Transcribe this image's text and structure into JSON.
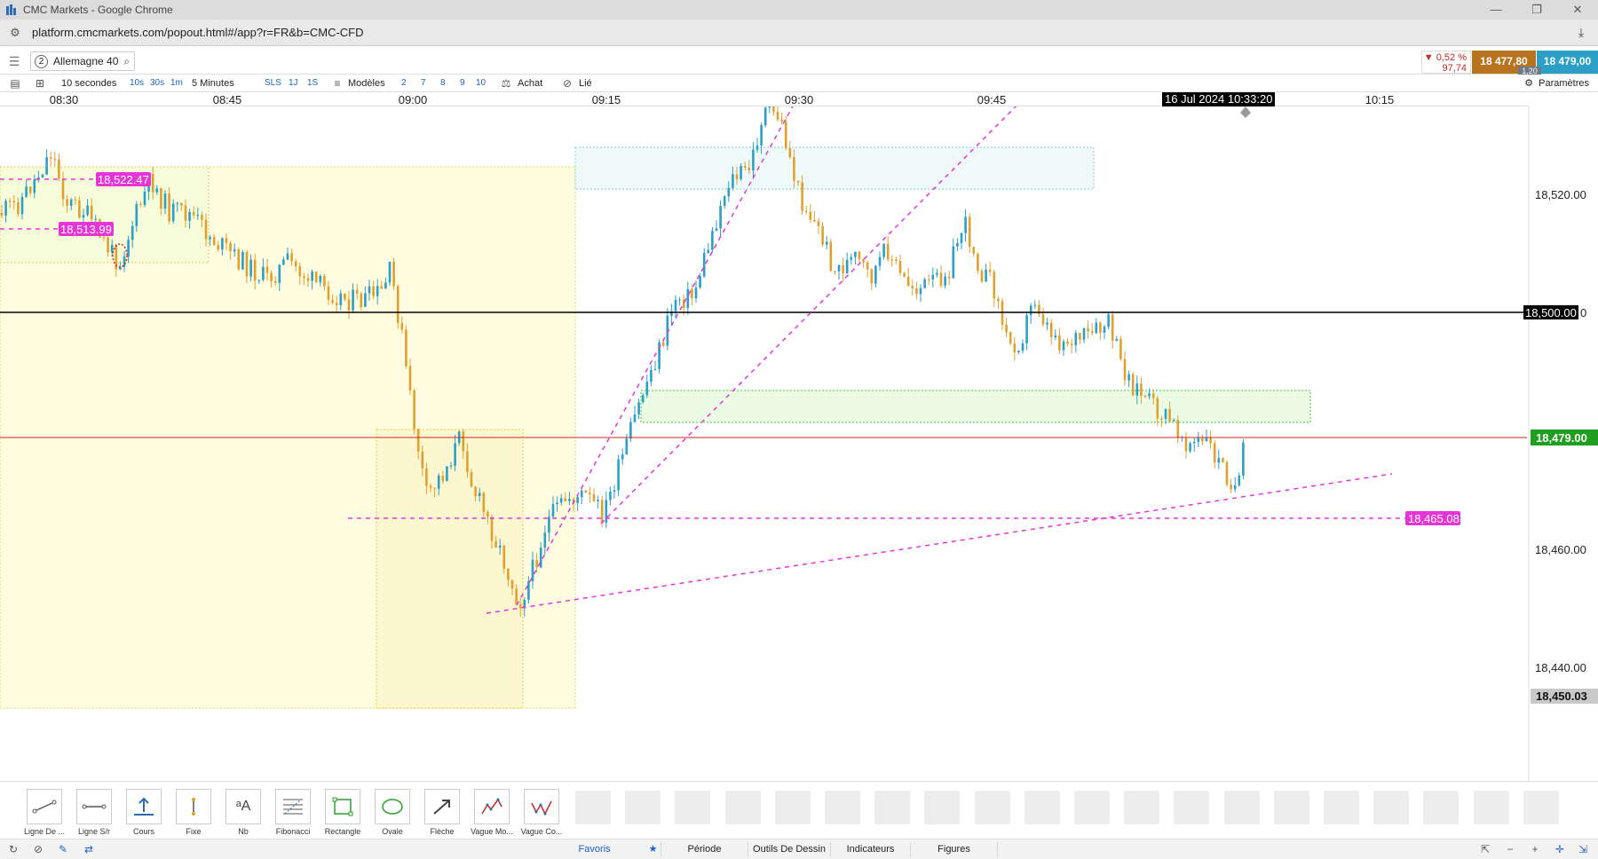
{
  "window": {
    "title": "CMC Markets - Google Chrome",
    "minimize": "—",
    "maximize": "❐",
    "close": "✕"
  },
  "browser": {
    "url": "platform.cmcmarkets.com/popout.html#/app?r=FR&b=CMC-CFD"
  },
  "header": {
    "instrument_number": "2",
    "instrument": "Allemagne 40",
    "change_pct": "▼ 0,52 %",
    "change_pts": "97,74",
    "sell_price": "18 477,80",
    "buy_price": "18 479,00",
    "spread": "1,20"
  },
  "toolbar": {
    "interval_label": "10 secondes",
    "btn_10s": "10s",
    "btn_30s": "30s",
    "btn_1m": "1m",
    "period_label": "5 Minutes",
    "btn_sls": "SLS",
    "btn_1j": "1J",
    "btn_1s": "1S",
    "templates": "Modèles",
    "n2": "2",
    "n7": "7",
    "n8": "8",
    "n9": "9",
    "n10": "10",
    "buy": "Achat",
    "linked": "Lié",
    "settings": "Paramètres"
  },
  "time_axis": {
    "ticks": [
      "08:30",
      "08:45",
      "09:00",
      "09:15",
      "09:30",
      "09:45",
      "10:15"
    ],
    "crosshair": "16 Jul 2024 10:33:20"
  },
  "chart_data": {
    "type": "candlestick",
    "instrument": "Allemagne 40",
    "y_ticks": [
      "18,520.00",
      "18,460.00",
      "18,440.00"
    ],
    "ylim": [
      18437,
      18533
    ],
    "labels": {
      "level_500": "18,500.00",
      "current_price": "18,479.00",
      "low_marker": "18,450.03",
      "hline_465": "18,465.08",
      "hline_522": "18,522.47",
      "hline_513": "18,513.99"
    },
    "levels": {
      "level_500": 18500.0,
      "current_price": 18479.0,
      "low_marker": 18450.03,
      "hline_465": 18465.08,
      "hline_522": 18522.47,
      "hline_513": 18513.99
    },
    "colors": {
      "up": "#2a9fc8",
      "down": "#e0a030",
      "pink": "#e535d9",
      "current": "#1f9e1f",
      "hover": "#000000"
    }
  },
  "drawing_tools": [
    {
      "label": "Ligne De ...",
      "icon": "line-icon"
    },
    {
      "label": "Ligne S/r",
      "icon": "sr-line-icon"
    },
    {
      "label": "Cours",
      "icon": "price-icon"
    },
    {
      "label": "Fixe",
      "icon": "fixed-icon"
    },
    {
      "label": "Nb",
      "icon": "text-icon"
    },
    {
      "label": "Fibonacci",
      "icon": "fibonacci-icon"
    },
    {
      "label": "Rectangle",
      "icon": "rectangle-icon"
    },
    {
      "label": "Ovale",
      "icon": "oval-icon"
    },
    {
      "label": "Flèche",
      "icon": "arrow-icon"
    },
    {
      "label": "Vague Mo...",
      "icon": "wave-motive-icon"
    },
    {
      "label": "Vague Co...",
      "icon": "wave-corrective-icon"
    }
  ],
  "bottom_tabs": {
    "favorites": "Favoris",
    "period": "Période",
    "drawing_tools": "Outils De Dessin",
    "indicators": "Indicateurs",
    "figures": "Figures"
  }
}
